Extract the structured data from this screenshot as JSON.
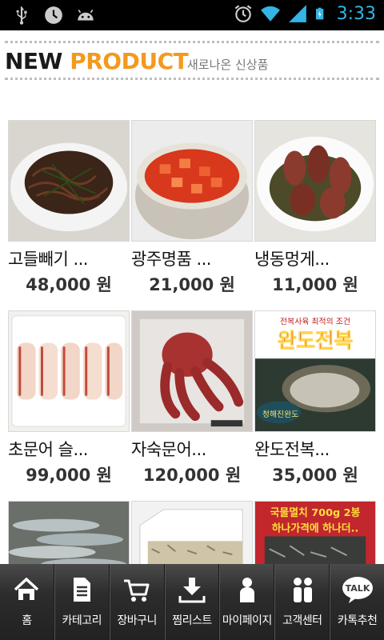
{
  "status_bar": {
    "time": "3:33",
    "left_icons": [
      "usb-icon",
      "alarm-clock-icon",
      "android-icon"
    ],
    "right_icons": [
      "alarm-icon",
      "wifi-icon",
      "signal-icon",
      "battery-charging-icon"
    ],
    "time_color": "#33b5e5"
  },
  "header": {
    "title_new": "NEW",
    "title_product": "PRODUCT",
    "subtitle": "새로나온 신상품",
    "accent_color": "#f39a1e"
  },
  "products": [
    {
      "name": "고들빼기 ...",
      "price": "48,000 원"
    },
    {
      "name": "광주명품 ...",
      "price": "21,000 원"
    },
    {
      "name": "냉동멍게...",
      "price": "11,000 원"
    },
    {
      "name": "초문어 슬...",
      "price": "99,000 원"
    },
    {
      "name": "자숙문어...",
      "price": "120,000 원"
    },
    {
      "name": "완도전복...",
      "price": "35,000 원"
    },
    {
      "name": "",
      "price": ""
    },
    {
      "name": "",
      "price": ""
    },
    {
      "name": "",
      "price": ""
    }
  ],
  "product_image_text": {
    "abalone_banner_top": "전복사육 최적의 조건",
    "abalone_banner_main": "완도전복",
    "abalone_brand": "청해진완도",
    "anchovy_banner_1": "국물멸치 700g 2봉",
    "anchovy_banner_2": "하나가격에 하나더.."
  },
  "bottom_nav": [
    {
      "label": "홈",
      "icon": "home-icon"
    },
    {
      "label": "카테고리",
      "icon": "document-icon"
    },
    {
      "label": "장바구니",
      "icon": "cart-icon"
    },
    {
      "label": "찜리스트",
      "icon": "download-icon"
    },
    {
      "label": "마이페이지",
      "icon": "person-icon"
    },
    {
      "label": "고객센터",
      "icon": "people-icon"
    },
    {
      "label": "카톡추천",
      "icon": "kakaotalk-icon"
    }
  ],
  "kakao_icon_text": "TALK"
}
